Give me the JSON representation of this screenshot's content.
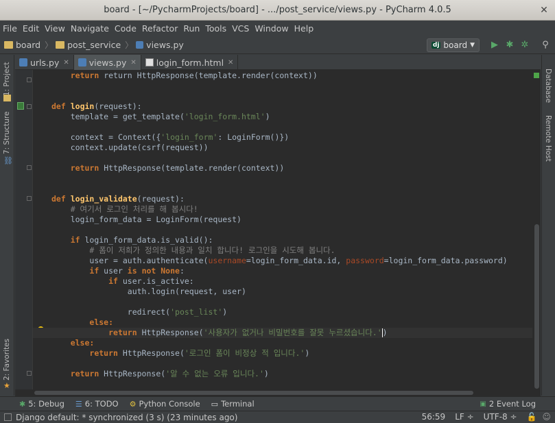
{
  "window": {
    "title": "board - [~/PycharmProjects/board] - .../post_service/views.py - PyCharm 4.0.5"
  },
  "menu": [
    "File",
    "Edit",
    "View",
    "Navigate",
    "Code",
    "Refactor",
    "Run",
    "Tools",
    "VCS",
    "Window",
    "Help"
  ],
  "breadcrumbs": [
    "board",
    "post_service",
    "views.py"
  ],
  "run_config": {
    "badge": "dj",
    "label": "board"
  },
  "tabs": [
    {
      "label": "urls.py",
      "icon": "python-file-icon",
      "active": false
    },
    {
      "label": "views.py",
      "icon": "python-file-icon",
      "active": true
    },
    {
      "label": "login_form.html",
      "icon": "html-file-icon",
      "active": false
    }
  ],
  "left_tools": {
    "project": "1: Project",
    "structure": "7: Structure",
    "favorites": "2: Favorites"
  },
  "right_tools": {
    "database": "Database",
    "remote": "Remote Host"
  },
  "code": {
    "l0": "return HttpResponse(template.render(context))",
    "login_def": "login",
    "login_param": "(request):",
    "l3": "template = get_template(",
    "l3s": "'login_form.html'",
    "l5a": "context = Context({",
    "l5s": "'login_form'",
    "l5b": ": LoginForm()})",
    "l6": "context.update(csrf(request))",
    "l8": "HttpResponse(template.render(context))",
    "lv_def": "login_validate",
    "lv_param": "(request):",
    "c1": "# 여기서 로그인 처리를 해 봅시다!",
    "l13": "login_form_data = LoginForm(request)",
    "l15": " login_form_data.is_valid():",
    "c2": "# 폼이 저희가 정의한 내용과 일치 합니다! 로그인을 시도해 봅니다.",
    "l17a": "user = auth.authenticate(",
    "l17p1": "username",
    "l17b": "=login_form_data.id, ",
    "l17p2": "password",
    "l17c": "=login_form_data.password)",
    "l18a": " user ",
    "l18b": "is not None",
    "l19": " user.is_active:",
    "l20": "auth.login(request, user)",
    "l22a": "redirect(",
    "l22s": "'post_list'",
    "l24a": " HttpResponse(",
    "l24s": "'사용자가 없거나 비밀번호를 잘못 누르셨습니다.'",
    "l26s": "'로그인 폼이 비정상 적 입니다.'",
    "l28s": "'알 수 없는 오류 입니다.'",
    "kw_return": "return",
    "kw_def": "def",
    "kw_if": "if",
    "kw_else": "else:",
    "close_paren": ")"
  },
  "toolwindows": [
    {
      "label": "5: Debug",
      "icon": "debug-icon"
    },
    {
      "label": "6: TODO",
      "icon": "todo-icon"
    },
    {
      "label": "Python Console",
      "icon": "python-console-icon"
    },
    {
      "label": "Terminal",
      "icon": "terminal-icon"
    }
  ],
  "event_log": "2 Event Log",
  "status": {
    "message": "Django default: * synchronized (3 s) (23 minutes ago)",
    "position": "56:59",
    "line_sep": "LF ÷",
    "encoding": "UTF-8 ÷"
  }
}
